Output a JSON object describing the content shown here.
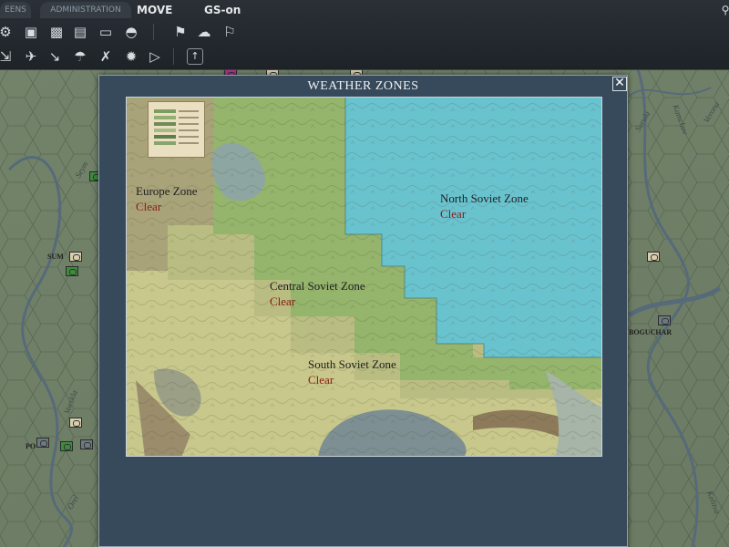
{
  "tabs": {
    "screens": "EENS",
    "administration": "ADMINISTRATION",
    "move": "MOVE",
    "gs": "GS-on"
  },
  "toolbar_row1_icons": [
    "settings-icon",
    "unit-icon",
    "truck-icon",
    "factory-icon",
    "frame-icon",
    "hq-icon",
    "flag-report-icon",
    "weather-icon",
    "flag-icon"
  ],
  "toolbar_row2_icons": [
    "attack-icon",
    "air-icon",
    "bombard-icon",
    "paradrop-icon",
    "tactical-icon",
    "explosion-icon",
    "play-icon",
    "up-arrow-icon"
  ],
  "background_map": {
    "cities": [
      "SUM",
      "BOGUCHAR",
      "PO"
    ],
    "rivers": [
      "Seym",
      "Surula",
      "Kamchov",
      "Verona",
      "Vorskla",
      "Orel",
      "Kalitva"
    ]
  },
  "dialog": {
    "title": "WEATHER ZONES",
    "close_label": "✕",
    "zones": [
      {
        "name": "Europe Zone",
        "status": "Clear"
      },
      {
        "name": "North Soviet Zone",
        "status": "Clear"
      },
      {
        "name": "Central Soviet Zone",
        "status": "Clear"
      },
      {
        "name": "South Soviet Zone",
        "status": "Clear"
      }
    ]
  },
  "colors": {
    "dialog_bg": "#364a5c",
    "north_zone": "#69c3cf",
    "central_zone": "#8fb36a",
    "south_zone": "#c6cb86",
    "europe_zone": "#a59f78",
    "status_text": "#8b1a12"
  }
}
